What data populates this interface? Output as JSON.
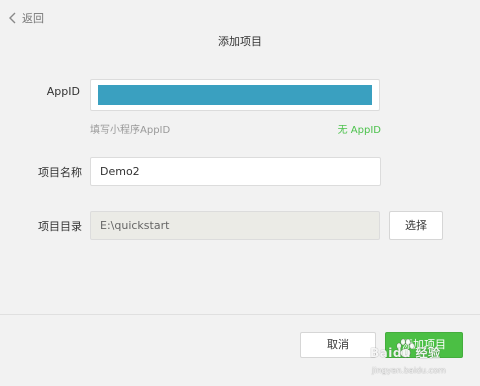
{
  "header": {
    "back_label": "返回",
    "title": "添加项目"
  },
  "form": {
    "appid": {
      "label": "AppID",
      "hint": "填写小程序AppID",
      "no_appid_link": "无 AppID",
      "fill_color": "#3aa0c0"
    },
    "project_name": {
      "label": "项目名称",
      "value": "Demo2"
    },
    "project_dir": {
      "label": "项目目录",
      "value": "E:\\quickstart",
      "choose_label": "选择"
    }
  },
  "footer": {
    "cancel_label": "取消",
    "add_label": "添加项目"
  },
  "watermark": {
    "text": "Baidu 经验",
    "subtext": "jingyan.baidu.com"
  },
  "colors": {
    "accent_green": "#4bbf44",
    "link_green": "#4cc24c",
    "background": "#f2f2f2"
  }
}
